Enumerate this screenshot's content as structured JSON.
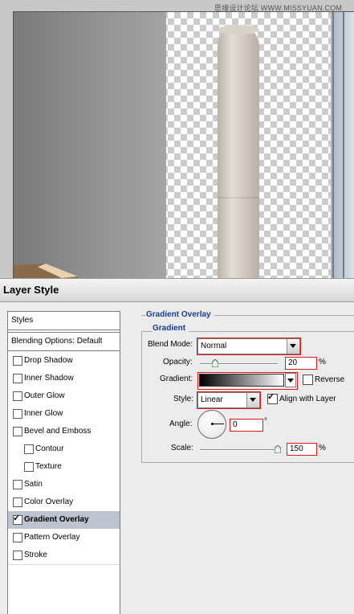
{
  "watermark": "思缘设计论坛 WWW.MISSYUAN.COM",
  "dialog": {
    "title": "Layer Style"
  },
  "styles_panel": {
    "header": "Styles",
    "blending_options": "Blending Options: Default",
    "items": [
      {
        "label": "Drop Shadow",
        "checked": false,
        "indent": false,
        "selected": false
      },
      {
        "label": "Inner Shadow",
        "checked": false,
        "indent": false,
        "selected": false
      },
      {
        "label": "Outer Glow",
        "checked": false,
        "indent": false,
        "selected": false
      },
      {
        "label": "Inner Glow",
        "checked": false,
        "indent": false,
        "selected": false
      },
      {
        "label": "Bevel and Emboss",
        "checked": false,
        "indent": false,
        "selected": false
      },
      {
        "label": "Contour",
        "checked": false,
        "indent": true,
        "selected": false
      },
      {
        "label": "Texture",
        "checked": false,
        "indent": true,
        "selected": false
      },
      {
        "label": "Satin",
        "checked": false,
        "indent": false,
        "selected": false
      },
      {
        "label": "Color Overlay",
        "checked": false,
        "indent": false,
        "selected": false
      },
      {
        "label": "Gradient Overlay",
        "checked": true,
        "indent": false,
        "selected": true
      },
      {
        "label": "Pattern Overlay",
        "checked": false,
        "indent": false,
        "selected": false
      },
      {
        "label": "Stroke",
        "checked": false,
        "indent": false,
        "selected": false
      }
    ]
  },
  "gradient_overlay": {
    "section_title": "Gradient Overlay",
    "group_title": "Gradient",
    "blend_mode_label": "Blend Mode:",
    "blend_mode_value": "Normal",
    "opacity_label": "Opacity:",
    "opacity_value": "20",
    "opacity_unit": "%",
    "opacity_percent": 20,
    "gradient_label": "Gradient:",
    "gradient_colors": [
      "#000000",
      "#ffffff"
    ],
    "reverse_label": "Reverse",
    "reverse_checked": false,
    "style_label": "Style:",
    "style_value": "Linear",
    "align_label": "Align with Layer",
    "align_checked": true,
    "angle_label": "Angle:",
    "angle_value": "0",
    "angle_unit": "°",
    "scale_label": "Scale:",
    "scale_value": "150",
    "scale_unit": "%",
    "scale_percent": 150
  },
  "colors": {
    "highlight_red": "#d81c1c",
    "section_blue": "#1a3c8a",
    "selected_row": "#bdc3cf"
  }
}
